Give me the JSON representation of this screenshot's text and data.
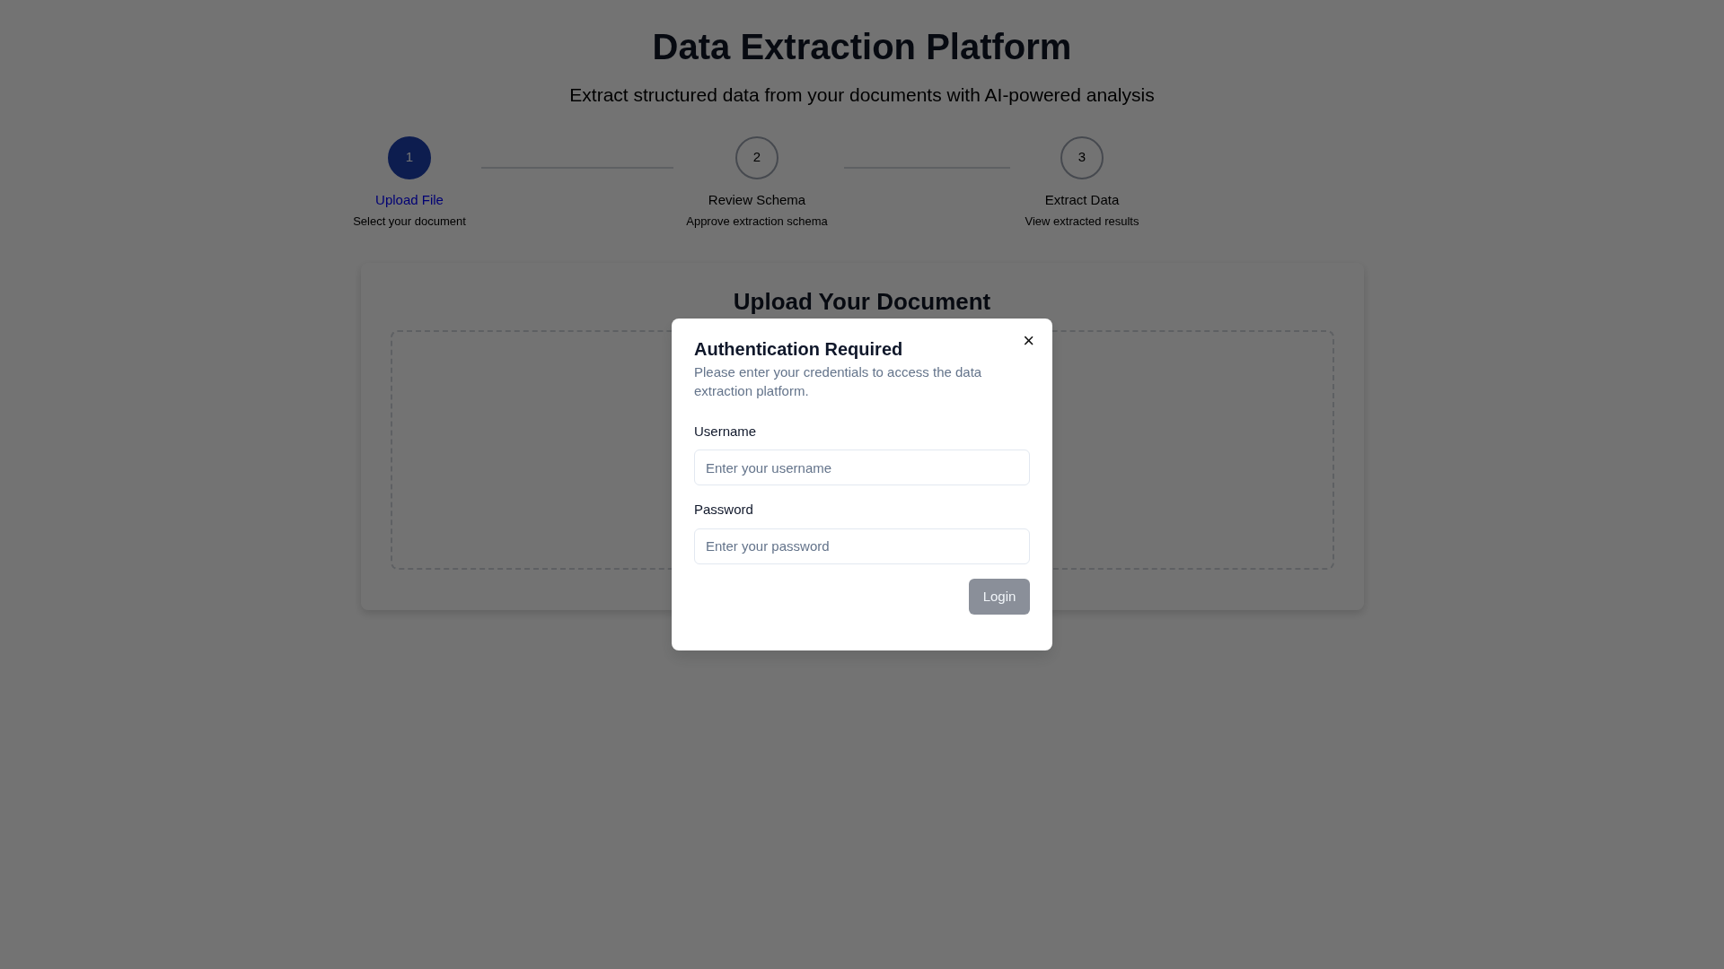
{
  "header": {
    "title": "Data Extraction Platform",
    "subtitle": "Extract structured data from your documents with AI-powered analysis"
  },
  "steps": [
    {
      "number": "1",
      "label": "Upload File",
      "description": "Select your document",
      "selected": true
    },
    {
      "number": "2",
      "label": "Review Schema",
      "description": "Approve extraction schema",
      "selected": false
    },
    {
      "number": "3",
      "label": "Extract Data",
      "description": "View extracted results",
      "selected": false
    }
  ],
  "upload_card": {
    "title": "Upload Your Document"
  },
  "dialog": {
    "title": "Authentication Required",
    "description": "Please enter your credentials to access the data extraction platform.",
    "close": "×",
    "fields": [
      {
        "label": "Username",
        "placeholder": "Enter your username"
      },
      {
        "label": "Password",
        "placeholder": "Enter your password"
      }
    ],
    "button": {
      "label": "Login",
      "disabled": true
    }
  }
}
